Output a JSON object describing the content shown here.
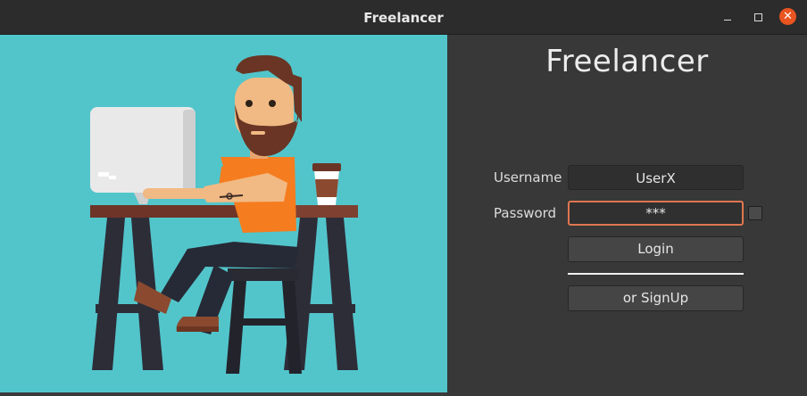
{
  "window": {
    "title": "Freelancer"
  },
  "form": {
    "app_title": "Freelancer",
    "username_label": "Username",
    "username_value": "UserX",
    "password_label": "Password",
    "password_value": "***",
    "login_label": "Login",
    "signup_label": "or SignUp"
  },
  "colors": {
    "illustration_bg": "#52c5cb",
    "close_button": "#e95420",
    "focus_border": "#e07650"
  },
  "icons": [
    "minimize-icon",
    "maximize-icon",
    "close-icon"
  ]
}
